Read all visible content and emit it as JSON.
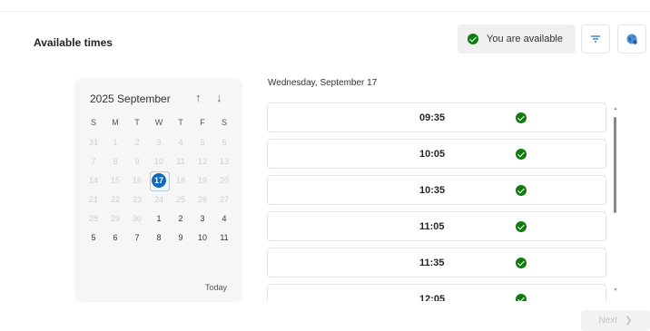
{
  "header": {
    "section_title": "Available times",
    "availability_label": "You are available"
  },
  "calendar": {
    "title": "2025 September",
    "weekdays": [
      "S",
      "M",
      "T",
      "W",
      "T",
      "F",
      "S"
    ],
    "weeks": [
      [
        {
          "d": "31",
          "c": false
        },
        {
          "d": "1",
          "c": false
        },
        {
          "d": "2",
          "c": false
        },
        {
          "d": "3",
          "c": false
        },
        {
          "d": "4",
          "c": false
        },
        {
          "d": "5",
          "c": false
        },
        {
          "d": "6",
          "c": false
        }
      ],
      [
        {
          "d": "7",
          "c": false
        },
        {
          "d": "8",
          "c": false
        },
        {
          "d": "9",
          "c": false
        },
        {
          "d": "10",
          "c": false
        },
        {
          "d": "11",
          "c": false
        },
        {
          "d": "12",
          "c": false
        },
        {
          "d": "13",
          "c": false
        }
      ],
      [
        {
          "d": "14",
          "c": false
        },
        {
          "d": "15",
          "c": false
        },
        {
          "d": "16",
          "c": false
        },
        {
          "d": "17",
          "c": true,
          "s": true
        },
        {
          "d": "18",
          "c": false
        },
        {
          "d": "19",
          "c": false
        },
        {
          "d": "20",
          "c": false
        }
      ],
      [
        {
          "d": "21",
          "c": false
        },
        {
          "d": "22",
          "c": false
        },
        {
          "d": "23",
          "c": false
        },
        {
          "d": "24",
          "c": false
        },
        {
          "d": "25",
          "c": false
        },
        {
          "d": "26",
          "c": false
        },
        {
          "d": "27",
          "c": false
        }
      ],
      [
        {
          "d": "28",
          "c": false
        },
        {
          "d": "29",
          "c": false
        },
        {
          "d": "30",
          "c": false
        },
        {
          "d": "1",
          "c": true
        },
        {
          "d": "2",
          "c": true
        },
        {
          "d": "3",
          "c": true
        },
        {
          "d": "4",
          "c": true
        }
      ],
      [
        {
          "d": "5",
          "c": true
        },
        {
          "d": "6",
          "c": true
        },
        {
          "d": "7",
          "c": true
        },
        {
          "d": "8",
          "c": true
        },
        {
          "d": "9",
          "c": true
        },
        {
          "d": "10",
          "c": true
        },
        {
          "d": "11",
          "c": true
        }
      ]
    ],
    "today_label": "Today"
  },
  "schedule": {
    "date_label": "Wednesday, September 17",
    "slots": [
      "09:35",
      "10:05",
      "10:35",
      "11:05",
      "11:35",
      "12:05"
    ]
  },
  "footer": {
    "next_label": "Next"
  },
  "colors": {
    "accent": "#0f6cbd",
    "available": "#107c10"
  }
}
